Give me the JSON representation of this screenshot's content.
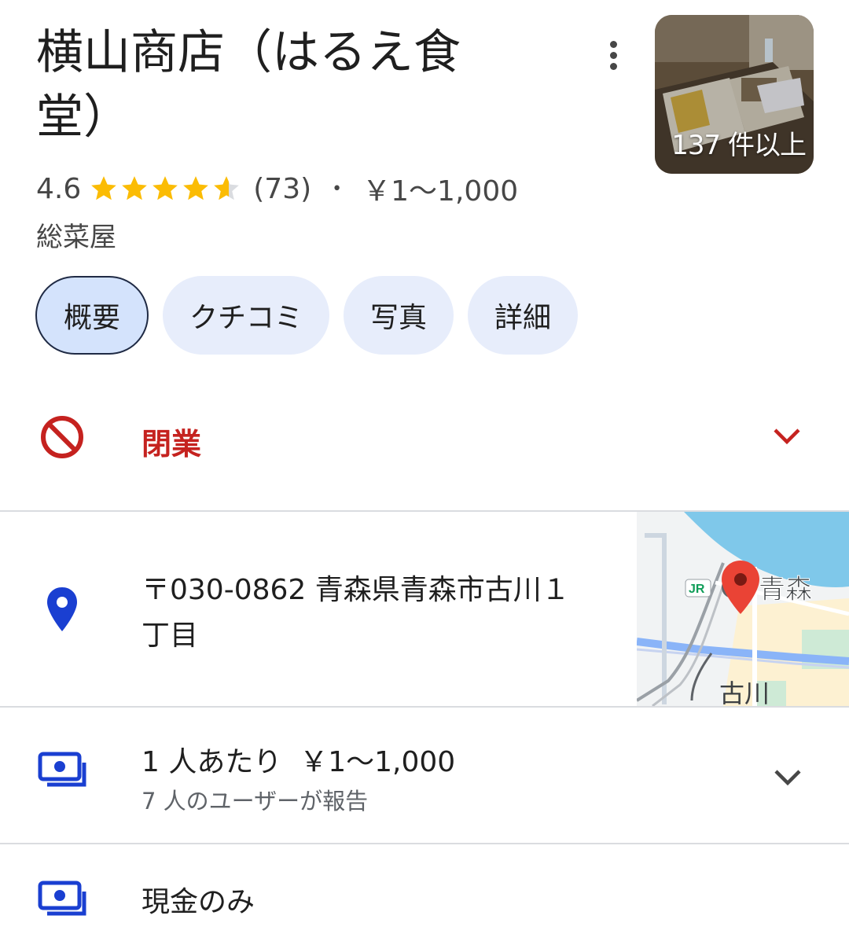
{
  "place": {
    "title": "横山商店（はるえ食堂）",
    "rating": "4.6",
    "rating_value": 4.6,
    "review_count": "(73)",
    "separator": "•",
    "price_range": "￥1〜1,000",
    "category": "総菜屋",
    "photo_count": "137 件以上"
  },
  "tabs": [
    "概要",
    "クチコミ",
    "写真",
    "詳細"
  ],
  "status": {
    "label": "閉業",
    "icon": "no-entry-icon",
    "color": "#c5221f"
  },
  "address": {
    "text": "〒030-0862 青森県青森市古川１丁目",
    "icon": "location-pin-icon"
  },
  "map": {
    "label_station_badge": "JR",
    "label_aomori": "青森",
    "label_furukawa": "古川"
  },
  "price": {
    "main": "1 人あたり  ￥1〜1,000",
    "sub": "7 人のユーザーが報告",
    "icon": "money-icon"
  },
  "payment": {
    "label": "現金のみ",
    "icon": "money-icon"
  },
  "colors": {
    "accent_blue": "#1a3fd1",
    "star": "#fbbc04",
    "closed_red": "#c5221f",
    "chip_bg": "#e7edfb"
  }
}
